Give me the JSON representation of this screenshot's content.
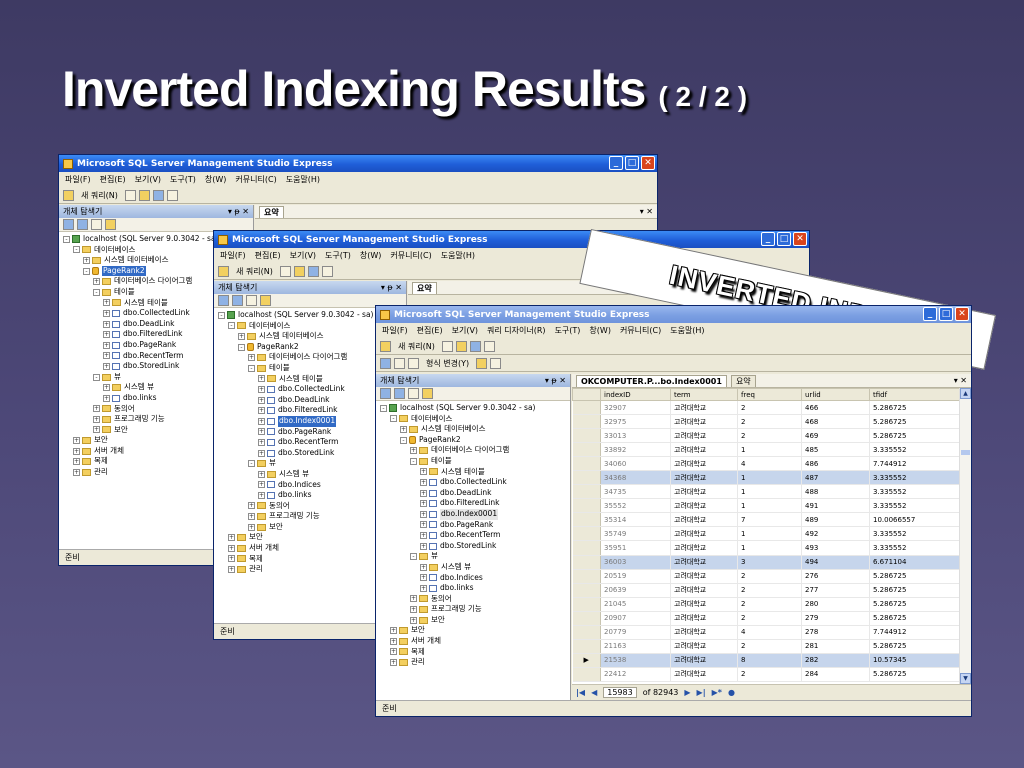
{
  "slide": {
    "title": "Inverted Indexing Results",
    "subtitle": "( 2 / 2 )"
  },
  "banner": {
    "text": "INVERTED INDEX"
  },
  "app": {
    "title": "Microsoft SQL Server Management Studio Express",
    "menu1": [
      "파일(F)",
      "편집(E)",
      "보기(V)",
      "도구(T)",
      "창(W)",
      "커뮤니티(C)",
      "도움말(H)"
    ],
    "menu3": [
      "파일(F)",
      "편집(E)",
      "보기(V)",
      "쿼리 디자이너(R)",
      "도구(T)",
      "창(W)",
      "커뮤니티(C)",
      "도움말(H)"
    ],
    "new_query": "새 쿼리(N)",
    "change_type": "형식 변경(Y)",
    "object_explorer": "개체 탐색기",
    "summary_tab": "요약",
    "table_tab": "OKCOMPUTER.P...bo.Index0001",
    "status": "준비"
  },
  "tree": [
    {
      "label": "localhost (SQL Server 9.0.3042 - sa)",
      "icon": "server-icon"
    },
    {
      "label": "데이터베이스",
      "icon": "folder-icon"
    },
    {
      "label": "시스템 데이터베이스",
      "icon": "folder-icon"
    },
    {
      "label": "PageRank2",
      "icon": "database-icon"
    },
    {
      "label": "데이터베이스 다이어그램",
      "icon": "folder-icon"
    },
    {
      "label": "테이블",
      "icon": "folder-icon"
    },
    {
      "label": "시스템 테이블",
      "icon": "folder-icon"
    },
    {
      "label": "dbo.CollectedLink",
      "icon": "table-icon"
    },
    {
      "label": "dbo.DeadLink",
      "icon": "table-icon"
    },
    {
      "label": "dbo.FilteredLink",
      "icon": "table-icon"
    },
    {
      "label": "dbo.Index0001",
      "icon": "table-icon"
    },
    {
      "label": "dbo.PageRank",
      "icon": "table-icon"
    },
    {
      "label": "dbo.RecentTerm",
      "icon": "table-icon"
    },
    {
      "label": "dbo.StoredLink",
      "icon": "table-icon"
    },
    {
      "label": "뷰",
      "icon": "folder-icon"
    },
    {
      "label": "시스템 뷰",
      "icon": "folder-icon"
    },
    {
      "label": "dbo.Indices",
      "icon": "view-icon"
    },
    {
      "label": "dbo.links",
      "icon": "view-icon"
    },
    {
      "label": "동의어",
      "icon": "folder-icon"
    },
    {
      "label": "프로그래밍 기능",
      "icon": "folder-icon"
    },
    {
      "label": "보안",
      "icon": "folder-icon"
    },
    {
      "label": "보안",
      "icon": "folder-icon"
    },
    {
      "label": "서버 개체",
      "icon": "folder-icon"
    },
    {
      "label": "복제",
      "icon": "folder-icon"
    },
    {
      "label": "관리",
      "icon": "folder-icon"
    }
  ],
  "grid": {
    "columns": [
      "indexID",
      "term",
      "freq",
      "urlid",
      "tfidf"
    ],
    "rows": [
      [
        "32907",
        "고려대학교",
        "2",
        "466",
        "5.286725"
      ],
      [
        "32975",
        "고려대학교",
        "2",
        "468",
        "5.286725"
      ],
      [
        "33013",
        "고려대학교",
        "2",
        "469",
        "5.286725"
      ],
      [
        "33892",
        "고려대학교",
        "1",
        "485",
        "3.335552"
      ],
      [
        "34060",
        "고려대학교",
        "4",
        "486",
        "7.744912"
      ],
      [
        "34368",
        "고려대학교",
        "1",
        "487",
        "3.335552"
      ],
      [
        "34735",
        "고려대학교",
        "1",
        "488",
        "3.335552"
      ],
      [
        "35552",
        "고려대학교",
        "1",
        "491",
        "3.335552"
      ],
      [
        "35314",
        "고려대학교",
        "7",
        "489",
        "10.0066557"
      ],
      [
        "35749",
        "고려대학교",
        "1",
        "492",
        "3.335552"
      ],
      [
        "35951",
        "고려대학교",
        "1",
        "493",
        "3.335552"
      ],
      [
        "36003",
        "고려대학교",
        "3",
        "494",
        "6.671104"
      ],
      [
        "20519",
        "고려대학교",
        "2",
        "276",
        "5.286725"
      ],
      [
        "20639",
        "고려대학교",
        "2",
        "277",
        "5.286725"
      ],
      [
        "21045",
        "고려대학교",
        "2",
        "280",
        "5.286725"
      ],
      [
        "20907",
        "고려대학교",
        "2",
        "279",
        "5.286725"
      ],
      [
        "20779",
        "고려대학교",
        "4",
        "278",
        "7.744912"
      ],
      [
        "21163",
        "고려대학교",
        "2",
        "281",
        "5.286725"
      ],
      [
        "21538",
        "고려대학교",
        "8",
        "282",
        "10.57345"
      ],
      [
        "22412",
        "고려대학교",
        "2",
        "284",
        "5.286725"
      ]
    ]
  },
  "nav": {
    "current": "15983",
    "of_total": "of 82943"
  }
}
